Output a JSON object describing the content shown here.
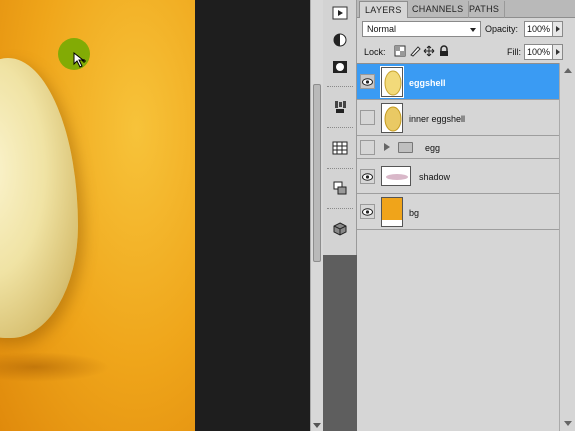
{
  "panel": {
    "tabs": [
      {
        "label": "LAYERS",
        "active": true
      },
      {
        "label": "CHANNELS",
        "active": false
      },
      {
        "label": "PATHS",
        "active": false
      }
    ],
    "blend_mode": "Normal",
    "opacity_label": "Opacity:",
    "opacity_value": "100%",
    "lock_label": "Lock:",
    "fill_label": "Fill:",
    "fill_value": "100%"
  },
  "layers": [
    {
      "name": "eggshell",
      "visible": true,
      "selected": true,
      "type": "layer"
    },
    {
      "name": "inner eggshell",
      "visible": false,
      "selected": false,
      "type": "layer"
    },
    {
      "name": "egg",
      "visible": false,
      "selected": false,
      "type": "group"
    },
    {
      "name": "shadow",
      "visible": true,
      "selected": false,
      "type": "layer"
    },
    {
      "name": "bg",
      "visible": true,
      "selected": false,
      "type": "layer"
    }
  ],
  "colors": {
    "selection": "#3a9bf3",
    "canvas_bg": "#efa51a",
    "cursor_highlight": "#6eaa00"
  },
  "icons": {
    "toolstrip": [
      "play-icon",
      "adjustments-icon",
      "mask-icon",
      "brush-preset-icon",
      "grid-icon",
      "clone-source-icon",
      "3d-icon"
    ]
  }
}
